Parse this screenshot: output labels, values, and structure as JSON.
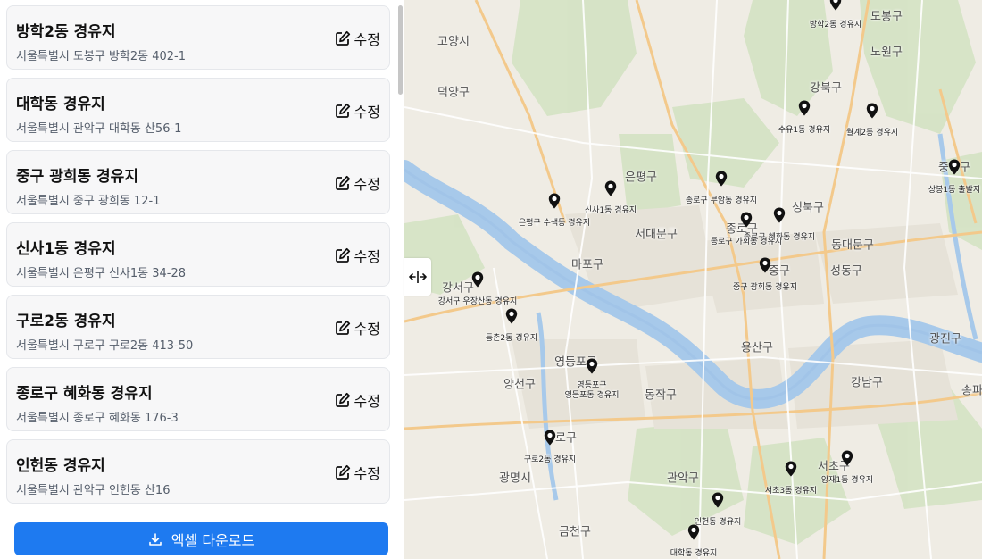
{
  "list": {
    "edit_label": "수정",
    "items": [
      {
        "name": "방학2동 경유지",
        "address": "서울특별시 도봉구 방학2동 402-1"
      },
      {
        "name": "대학동 경유지",
        "address": "서울특별시 관악구 대학동 산56-1"
      },
      {
        "name": "중구 광희동 경유지",
        "address": "서울특별시 중구 광희동 12-1"
      },
      {
        "name": "신사1동 경유지",
        "address": "서울특별시 은평구 신사1동 34-28"
      },
      {
        "name": "구로2동 경유지",
        "address": "서울특별시 구로구 구로2동 413-50"
      },
      {
        "name": "종로구 혜화동 경유지",
        "address": "서울특별시 종로구 혜화동 176-3"
      },
      {
        "name": "인헌동 경유지",
        "address": "서울특별시 관악구 인헌동 산16"
      }
    ]
  },
  "download": {
    "label": "엑셀 다운로드"
  },
  "map": {
    "districts": [
      "도봉구",
      "고양시",
      "노원구",
      "덕양구",
      "강북구",
      "은평구",
      "중랑구",
      "성북구",
      "서대문구",
      "종로구",
      "동대문구",
      "마포구",
      "중구",
      "성동구",
      "강서구",
      "용산구",
      "광진구",
      "영등포구",
      "양천구",
      "동작구",
      "강남구",
      "송파",
      "구로구",
      "서초구",
      "광명시",
      "관악구",
      "금천구"
    ],
    "markers": [
      "방학2동 경유지",
      "수유1동 경유지",
      "월계2동 경유지",
      "상봉1동 출발지",
      "종로구 부암동 경유지",
      "신사1동 경유지",
      "은평구 수색동 경유지",
      "종로구 혜화동 경유지",
      "종로구 가회동 경유지",
      "중구 광희동 경유지",
      "강서구 우장산동 경유지",
      "등촌2동 경유지",
      "영등포구 영등포동 경유지",
      "구로2동 경유지",
      "서초3동 경유지",
      "양재1동 경유지",
      "인헌동 경유지",
      "대학동 경유지"
    ]
  }
}
